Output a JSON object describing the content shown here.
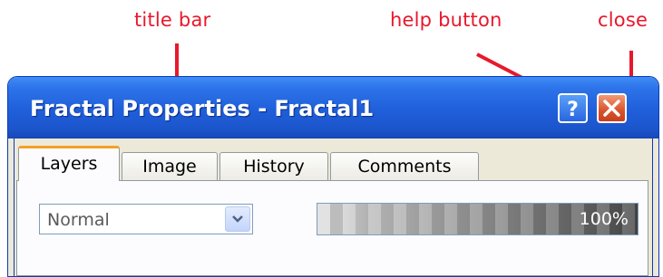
{
  "annotations": {
    "title_bar": "title bar",
    "help_button": "help button",
    "close": "close"
  },
  "window": {
    "title": "Fractal Properties - Fractal1",
    "caption_buttons": [
      {
        "name": "help-button",
        "glyph": "?",
        "icon": "question-mark-icon"
      },
      {
        "name": "close-button",
        "glyph": "✕",
        "icon": "close-icon"
      }
    ]
  },
  "tabs": [
    {
      "label": "Layers",
      "active": true
    },
    {
      "label": "Image",
      "active": false
    },
    {
      "label": "History",
      "active": false
    },
    {
      "label": "Comments",
      "active": false
    }
  ],
  "layers_panel": {
    "blend_mode": {
      "value": "Normal",
      "icon": "chevron-down-icon"
    },
    "opacity": {
      "value": "100%",
      "level": 1.0
    }
  },
  "colors": {
    "annotation": "#e8182c",
    "titlebar": "#1f5fd9",
    "active_tab_accent": "#f3a127"
  }
}
